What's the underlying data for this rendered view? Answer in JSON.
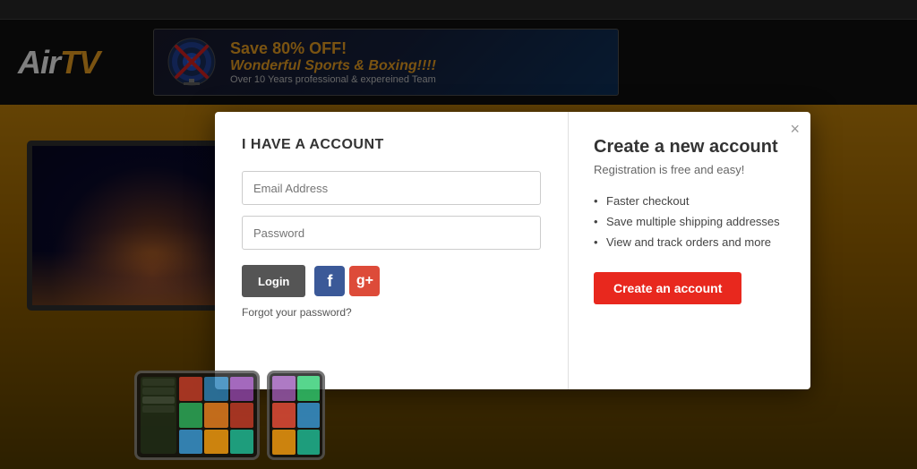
{
  "site": {
    "logo_air": "Air",
    "logo_tv": "TV",
    "topbar_text": ""
  },
  "banner": {
    "save_text": "Save 80% OFF!",
    "sports_text": "Wonderful Sports & Boxing!!!!",
    "sub_text": "Over 10 Years professional & expereined Team",
    "no_dish_label": "No Dish"
  },
  "modal": {
    "close_label": "×",
    "left": {
      "title": "I HAVE A ACCOUNT",
      "email_placeholder": "Email Address",
      "password_placeholder": "Password",
      "login_button": "Login",
      "forgot_password": "Forgot your password?"
    },
    "right": {
      "title": "Create a new account",
      "subtitle": "Registration is free and easy!",
      "benefits": [
        "Faster checkout",
        "Save multiple shipping addresses",
        "View and track orders and more"
      ],
      "create_button": "Create an account"
    }
  }
}
